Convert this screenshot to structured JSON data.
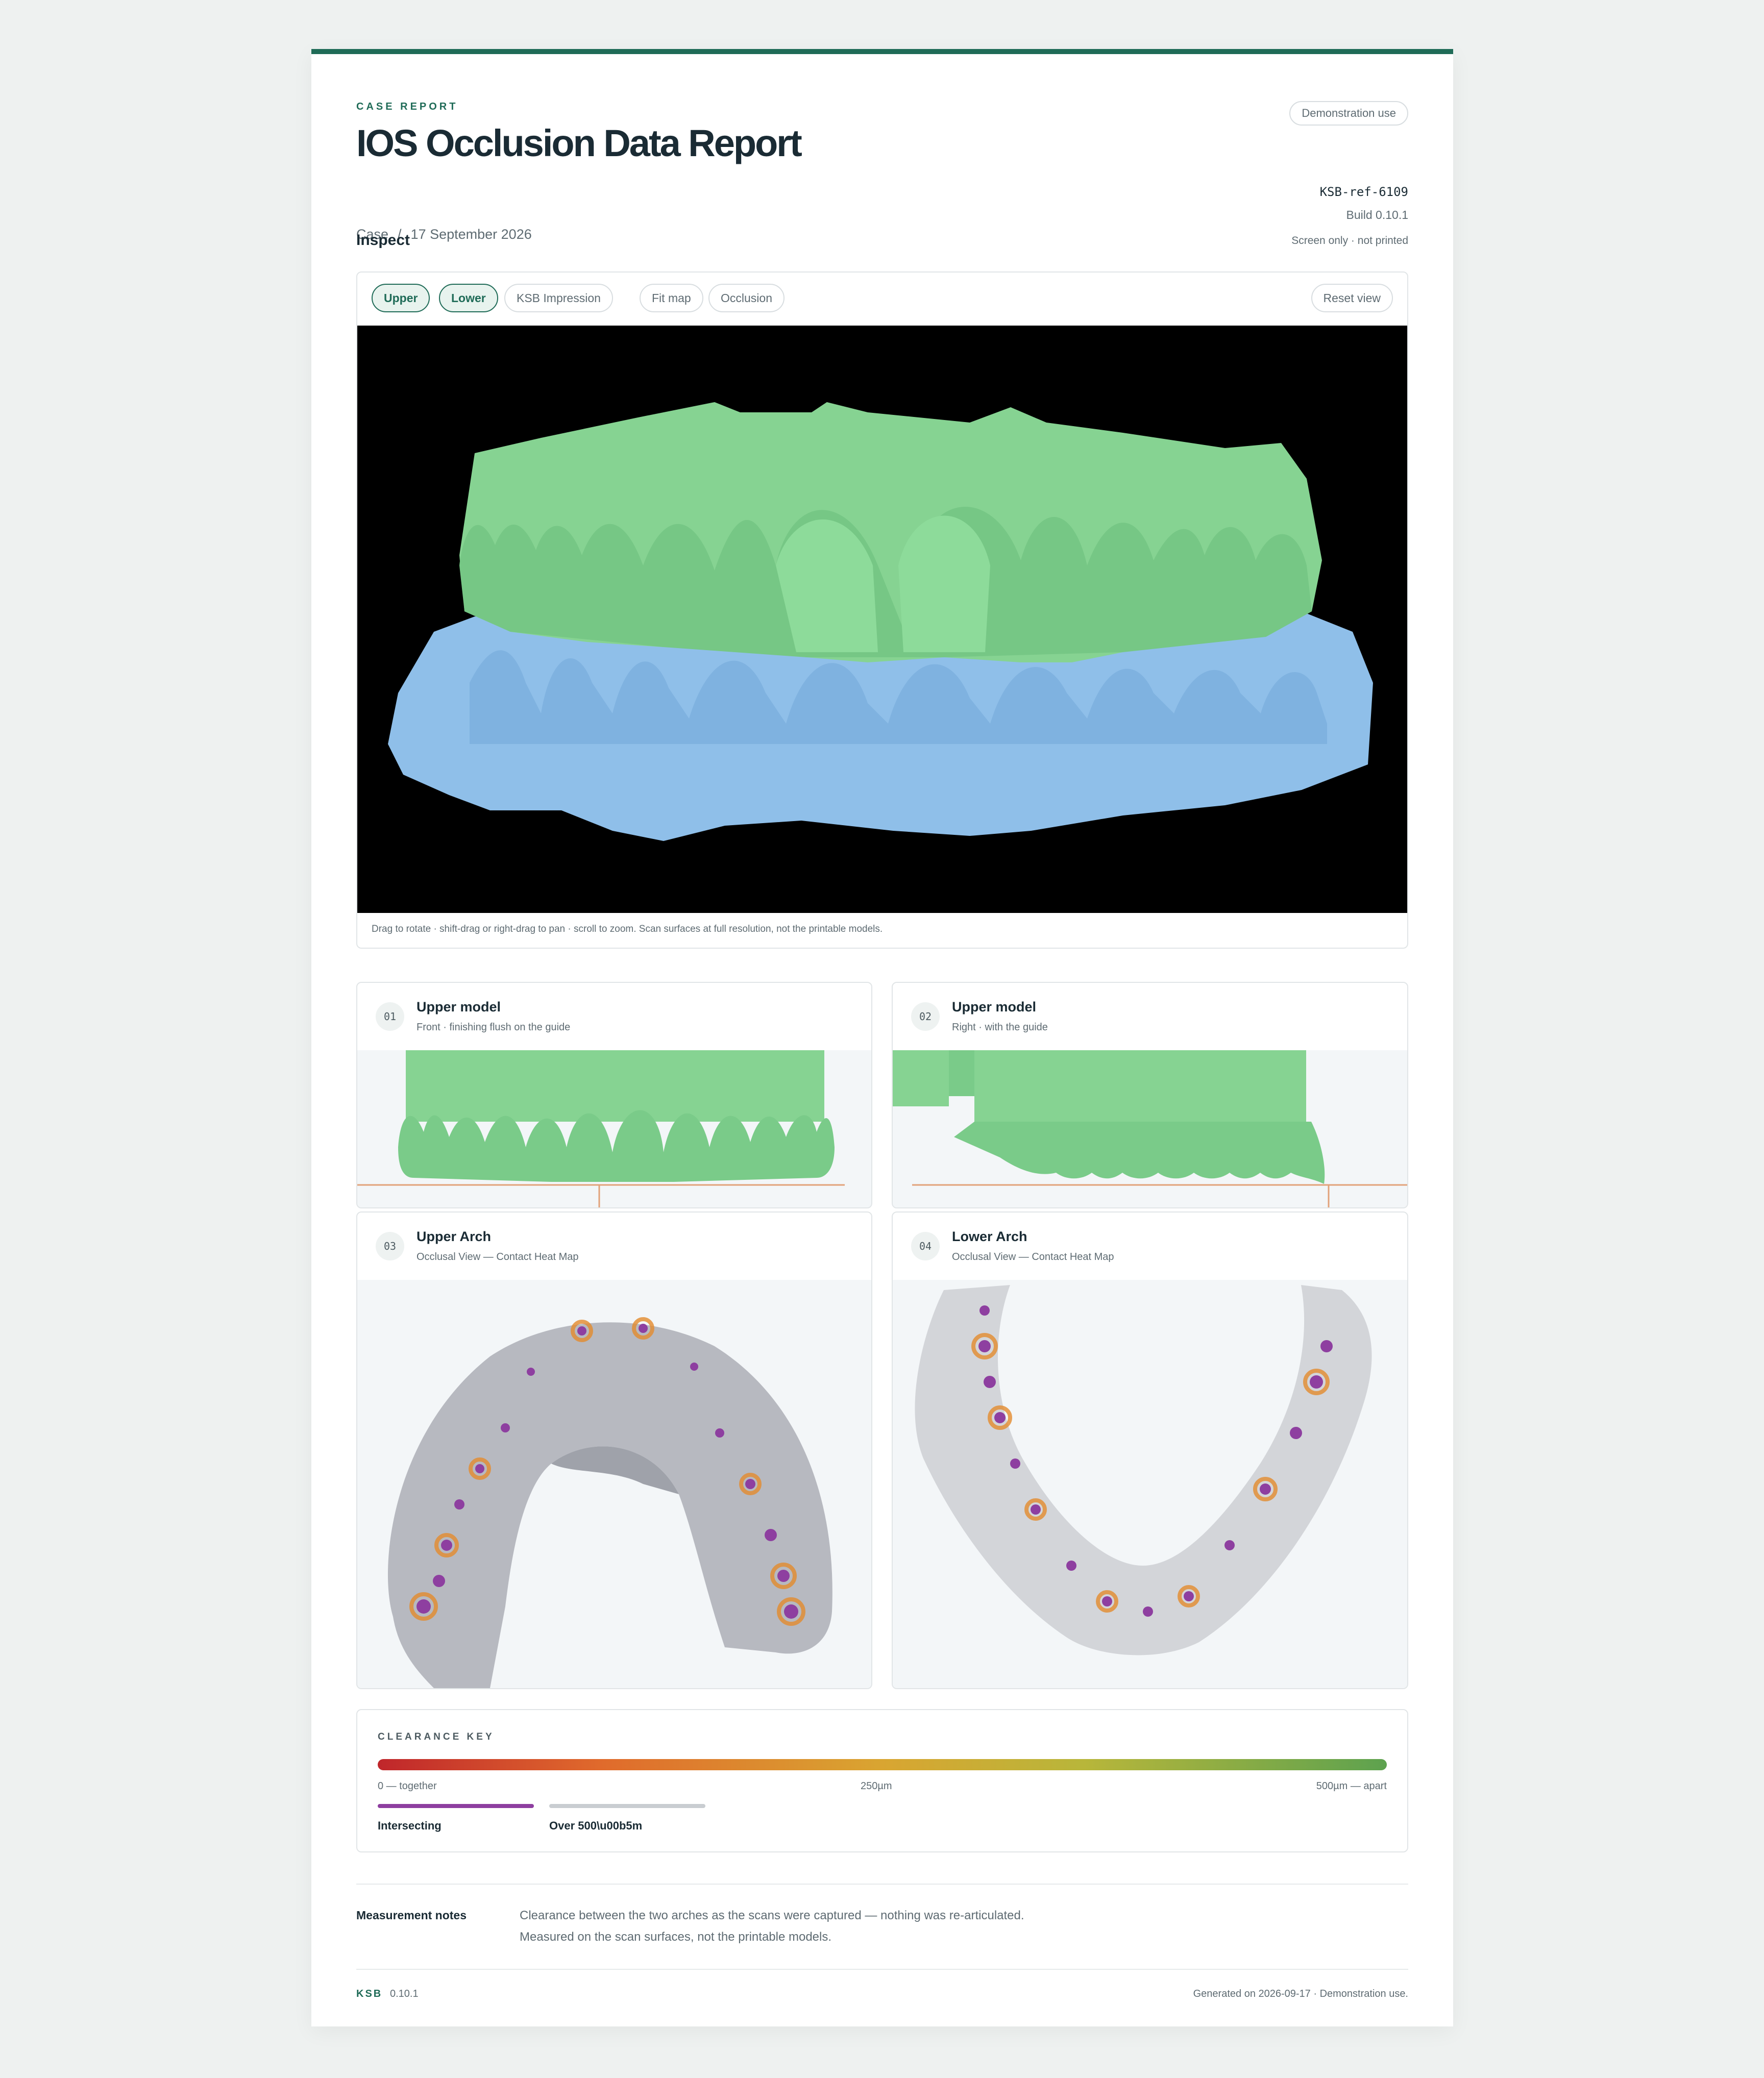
{
  "header": {
    "eyebrow": "CASE REPORT",
    "title": "IOS Occlusion Data Report",
    "breadcrumb_case": "Case",
    "breadcrumb_sep": "/",
    "date": "17 September 2026",
    "badge": "Demonstration use",
    "reference": "KSB-ref-6109",
    "build": "Build 0.10.1"
  },
  "inspect": {
    "title": "Inspect",
    "note": "Screen only · not printed",
    "toolbar": {
      "upper": "Upper",
      "lower": "Lower",
      "impression": "KSB Impression",
      "fit_map": "Fit map",
      "occlusion": "Occlusion",
      "reset": "Reset view"
    },
    "caption": "Drag to rotate · shift-drag or right-drag to pan · scroll to zoom. Scan surfaces at full resolution, not the printable models."
  },
  "views": [
    {
      "num": "01",
      "title": "Upper model",
      "subtitle": "Front · finishing flush on the guide"
    },
    {
      "num": "02",
      "title": "Upper model",
      "subtitle": "Right · with the guide"
    },
    {
      "num": "03",
      "title": "Upper Arch",
      "subtitle": "Occlusal View — Contact Heat Map"
    },
    {
      "num": "04",
      "title": "Lower Arch",
      "subtitle": "Occlusal View — Contact Heat Map"
    }
  ],
  "clearance_key": {
    "title": "CLEARANCE KEY",
    "min_label": "0 — together",
    "mid_label": "250µm",
    "max_label": "500µm — apart",
    "intersecting_label": "Intersecting",
    "over_label": "Over 500\\u00b5m",
    "colors": {
      "together": "#c0262b",
      "mid": "#d9a531",
      "apart": "#5da24f",
      "intersecting": "#8e3fa0",
      "over": "#c9cdd1"
    }
  },
  "notes": {
    "label": "Measurement notes",
    "line1": "Clearance between the two arches as the scans were captured — nothing was re-articulated.",
    "line2": "Measured on the scan surfaces, not the printable models."
  },
  "footer": {
    "brand": "KSB",
    "version": "0.10.1",
    "generated": "Generated on 2026-09-17 · Demonstration use."
  },
  "colors": {
    "accent": "#1f6b57",
    "upper_model": "#86d392",
    "lower_model": "#8fbfe9",
    "guide_line": "#e2a27a"
  }
}
